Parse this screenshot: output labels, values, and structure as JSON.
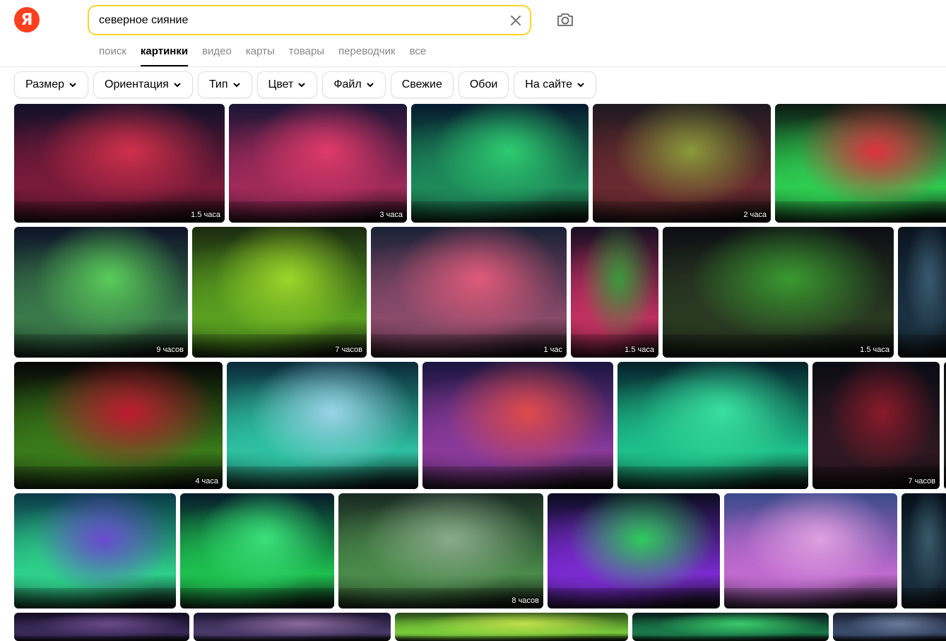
{
  "header": {
    "logo_letter": "Я",
    "search": {
      "value": "северное сияние"
    },
    "tabs": [
      {
        "label": "поиск"
      },
      {
        "label": "картинки"
      },
      {
        "label": "видео"
      },
      {
        "label": "карты"
      },
      {
        "label": "товары"
      },
      {
        "label": "переводчик"
      },
      {
        "label": "все"
      }
    ],
    "active_tab": "картинки"
  },
  "filters": [
    {
      "label": "Размер",
      "dropdown": true
    },
    {
      "label": "Ориентация",
      "dropdown": true
    },
    {
      "label": "Тип",
      "dropdown": true
    },
    {
      "label": "Цвет",
      "dropdown": true
    },
    {
      "label": "Файл",
      "dropdown": true
    },
    {
      "label": "Свежие",
      "dropdown": false
    },
    {
      "label": "Обои",
      "dropdown": false
    },
    {
      "label": "На сайте",
      "dropdown": true
    }
  ],
  "results": {
    "row1": [
      {
        "badge": "1.5 часа",
        "palette": [
          "#121028",
          "#7a1a3a",
          "#d0304a"
        ]
      },
      {
        "badge": "3 часа",
        "palette": [
          "#1a1535",
          "#a02a5a",
          "#e03a6a"
        ]
      },
      {
        "badge": "",
        "palette": [
          "#061a2e",
          "#1e8a5a",
          "#2ecc71"
        ]
      },
      {
        "badge": "2 часа",
        "palette": [
          "#1e1a20",
          "#6a2a30",
          "#8a9a3a"
        ]
      },
      {
        "badge": "",
        "palette": [
          "#0c1a14",
          "#2ecc50",
          "#e03040"
        ]
      }
    ],
    "row2": [
      {
        "badge": "9 часов",
        "palette": [
          "#0e1428",
          "#3a7a4a",
          "#5acc5a"
        ]
      },
      {
        "badge": "7 часов",
        "palette": [
          "#1a2a10",
          "#5aa020",
          "#9cd62a"
        ]
      },
      {
        "badge": "1 час",
        "palette": [
          "#1a2236",
          "#8a4a6a",
          "#e05a7a"
        ]
      },
      {
        "badge": "1.5 часа",
        "palette": [
          "#180e22",
          "#c03060",
          "#3a9a3a"
        ]
      },
      {
        "badge": "1.5 часа",
        "palette": [
          "#0e0e14",
          "#2a3a22",
          "#3a9a30"
        ]
      },
      {
        "badge": "",
        "palette": [
          "#0a1420",
          "#1a3040",
          "#3a5a70"
        ]
      }
    ],
    "row3": [
      {
        "badge": "4 часа",
        "palette": [
          "#050505",
          "#3a7a1a",
          "#c01a30"
        ]
      },
      {
        "badge": "",
        "palette": [
          "#0a2a3a",
          "#2ec0a0",
          "#9ad4e8"
        ]
      },
      {
        "badge": "",
        "palette": [
          "#1a1640",
          "#8a3a9a",
          "#e04a4a"
        ]
      },
      {
        "badge": "",
        "palette": [
          "#05202a",
          "#1ec08a",
          "#3ae0a0"
        ]
      },
      {
        "badge": "7 часов",
        "palette": [
          "#0a0c14",
          "#301822",
          "#8a1a2a"
        ]
      },
      {
        "badge": "",
        "palette": [
          "#101010",
          "#202020",
          "#303030"
        ]
      }
    ],
    "row4": [
      {
        "badge": "",
        "palette": [
          "#0a3a4a",
          "#2ed08a",
          "#6a4ad0"
        ]
      },
      {
        "badge": "",
        "palette": [
          "#061a2a",
          "#1ec050",
          "#3ae07a"
        ]
      },
      {
        "badge": "8 часов",
        "palette": [
          "#1a2a22",
          "#4a8a4a",
          "#8aaa8a"
        ]
      },
      {
        "badge": "",
        "palette": [
          "#0a0c20",
          "#7a2ad0",
          "#2ecc5a"
        ]
      },
      {
        "badge": "",
        "palette": [
          "#3a4a8a",
          "#c06ad0",
          "#e0a0e0"
        ]
      },
      {
        "badge": "",
        "palette": [
          "#06101a",
          "#1a3040",
          "#3a5a6a"
        ]
      }
    ],
    "row5": [
      {
        "badge": "",
        "palette": [
          "#120c20",
          "#3a2a5a",
          "#6a4a8a"
        ]
      },
      {
        "badge": "",
        "palette": [
          "#1a1430",
          "#4a3a6a",
          "#8a6a9a"
        ]
      },
      {
        "badge": "",
        "palette": [
          "#2a4a1a",
          "#7acc3a",
          "#c0e04a"
        ]
      },
      {
        "badge": "",
        "palette": [
          "#0a1a1a",
          "#1a7a4a",
          "#3acc6a"
        ]
      },
      {
        "badge": "",
        "palette": [
          "#1a2030",
          "#3a4a6a",
          "#6a7a9a"
        ]
      }
    ]
  }
}
